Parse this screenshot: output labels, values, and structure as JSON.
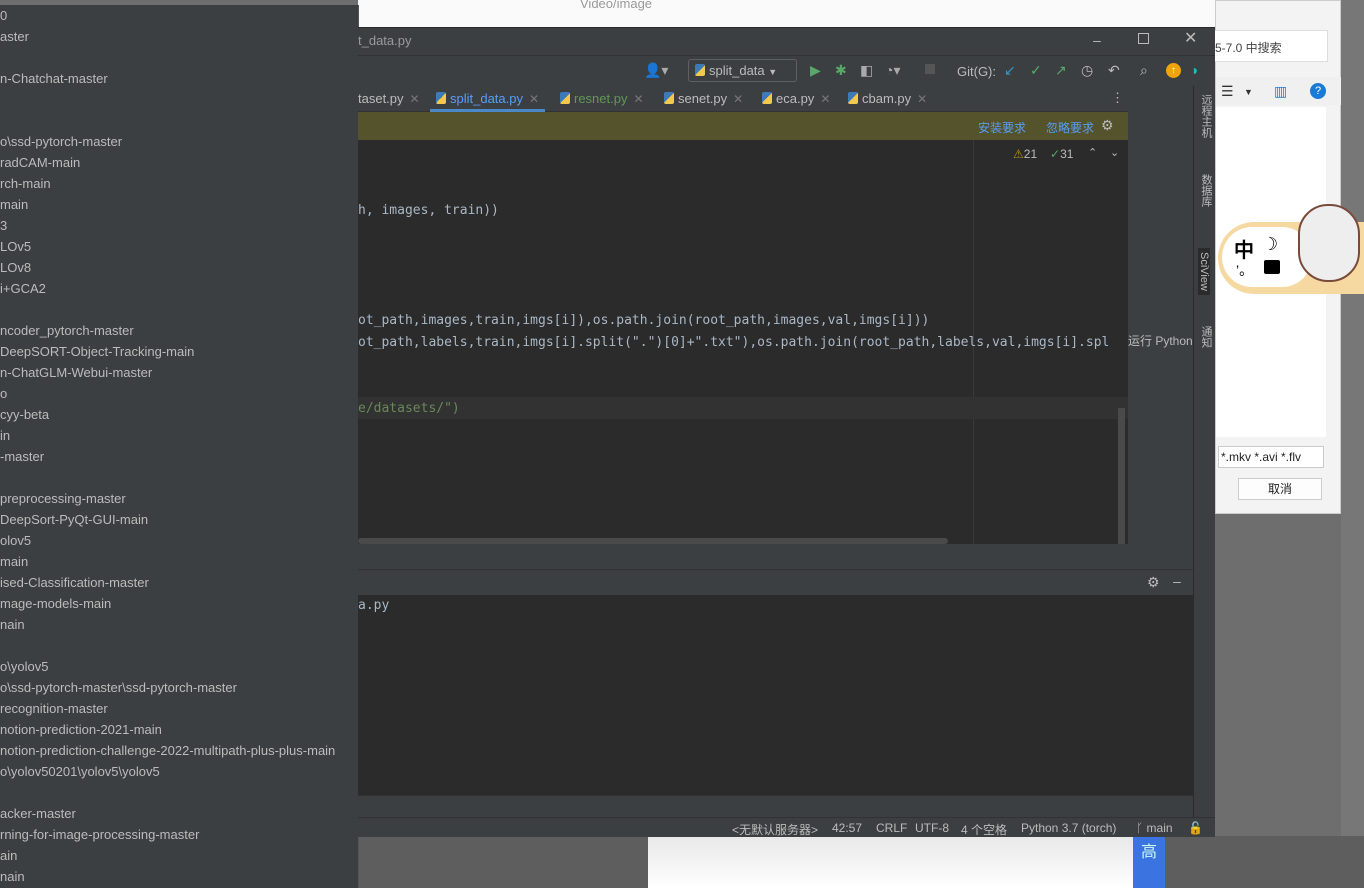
{
  "background": {
    "explorer_title": "Video/image",
    "dialog_search_placeholder": "5-7.0 中搜索",
    "dialog_filter": "*.mkv *.avi *.flv",
    "dialog_cancel": "取消",
    "ime_chars": [
      "中",
      "☽",
      "’。",
      "👕"
    ],
    "taskbar_char": "高"
  },
  "left_panel": {
    "items": [
      "0",
      "aster",
      "",
      "n-Chatchat-master",
      "",
      "",
      "o\\ssd-pytorch-master",
      "radCAM-main",
      "rch-main",
      "main",
      "3",
      "LOv5",
      "LOv8",
      "i+GCA2",
      "",
      "ncoder_pytorch-master",
      "DeepSORT-Object-Tracking-main",
      "n-ChatGLM-Webui-master",
      "o",
      "cyy-beta",
      "in",
      "-master",
      "",
      "preprocessing-master",
      "DeepSort-PyQt-GUI-main",
      "olov5",
      "main",
      "ised-Classification-master",
      "mage-models-main",
      "nain",
      "",
      "o\\yolov5",
      "o\\ssd-pytorch-master\\ssd-pytorch-master",
      "recognition-master",
      "notion-prediction-2021-main",
      "notion-prediction-challenge-2022-multipath-plus-plus-main",
      "o\\yolov50201\\yolov5\\yolov5",
      "",
      "acker-master",
      "rning-for-image-processing-master",
      "ain",
      "nain"
    ]
  },
  "ide": {
    "title": "t_data.py",
    "run_config": "split_data",
    "git_label": "Git(G):",
    "tabs": [
      {
        "label": "taset.py",
        "active": false
      },
      {
        "label": "split_data.py",
        "active": true
      },
      {
        "label": "resnet.py",
        "active": false,
        "color": "#629755"
      },
      {
        "label": "senet.py",
        "active": false
      },
      {
        "label": "eca.py",
        "active": false
      },
      {
        "label": "cbam.py",
        "active": false
      }
    ],
    "tab_overflow": "S",
    "banner": {
      "install": "安装要求",
      "ignore": "忽略要求"
    },
    "inspections": {
      "warnings": "21",
      "typos": "31"
    },
    "side_tools": [
      "远程主机",
      "数据库",
      "SciView",
      "通知"
    ],
    "run_python_label": "运行 Python",
    "code_lines": [
      {
        "t": "h, images, train))"
      },
      {
        "t": "ot_path,images,train,imgs[i]),os.path.join(root_path,images,val,imgs[i]))"
      },
      {
        "t": "ot_path,labels,train,imgs[i].split(\".\")[0]+\".txt\"),os.path.join(root_path,labels,val,imgs[i].spl"
      },
      {
        "t": "e/datasets/\")"
      }
    ],
    "console_text": "a.py",
    "status": {
      "server": "<无默认服务器>",
      "position": "42:57",
      "line_sep": "CRLF",
      "encoding": "UTF-8",
      "indent": "4 个空格",
      "interpreter": "Python 3.7 (torch)",
      "branch": "main"
    }
  },
  "colors": {
    "ide_bg": "#3c3f41",
    "editor_bg": "#2b2b2b",
    "banner": "#54532b",
    "link": "#589df6",
    "run_green": "#59a869"
  }
}
